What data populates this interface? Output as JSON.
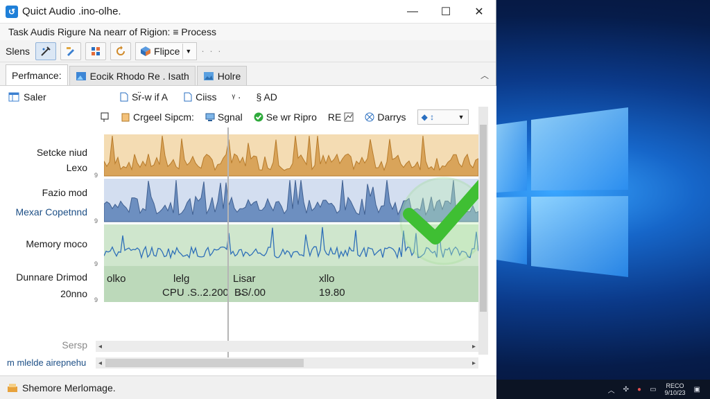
{
  "window": {
    "title": "Quict Audio .ino-olhe.",
    "minimize": "—",
    "maximize": "☐",
    "close": "✕"
  },
  "menubar": {
    "text": "Task Audis Rigure Na nearr of Rigion: ≡ Process"
  },
  "toolbar": {
    "label": "Slens",
    "combo_label": "Flipce",
    "more": "· · ·"
  },
  "tabs": [
    {
      "label": "Perfmance:"
    },
    {
      "label": "Eocik Rhodo Re . Isath"
    },
    {
      "label": "Holre"
    }
  ],
  "content": {
    "saler": "Saler",
    "row1": {
      "item1": "Sr̈-w if A",
      "item2": "Ciiss",
      "item3": "ᵞ ·",
      "item4": "§ AD"
    },
    "row2": {
      "item1": "Crgeel Sipcm:",
      "item2": "Sgnal",
      "item3": "Se wr Ripro",
      "item4": "RE",
      "item5": "Darrys",
      "zoom": "◆ ↕"
    },
    "labels": {
      "l1a": "Setcke niud",
      "l1b": "Lexo",
      "l2a": "Fazio mod",
      "l2b": "Mexar Copetnnd",
      "l3": "Memory moco",
      "l4a": "Dunnare Drimod",
      "l4b": "20nno",
      "scrap": "Sersp",
      "foot": "m mlelde airepnehu"
    },
    "tick": "9",
    "summary": {
      "h1": "olko",
      "h2": "lelg",
      "h3": "Lisar",
      "h4": "xllo",
      "v1": "CPU .S..2.200",
      "v2": "B̶S/.00",
      "v3": "19.80"
    }
  },
  "status": {
    "text": "Shemore Merlomage."
  },
  "taskbar": {
    "clock1": "RECO",
    "clock2": "9/10/23"
  },
  "colors": {
    "cpu": "#d9a45a",
    "disk": "#5b7fb0",
    "memory": "#6fb56f",
    "accent": "#1e7fd8",
    "check": "#44c23b"
  }
}
